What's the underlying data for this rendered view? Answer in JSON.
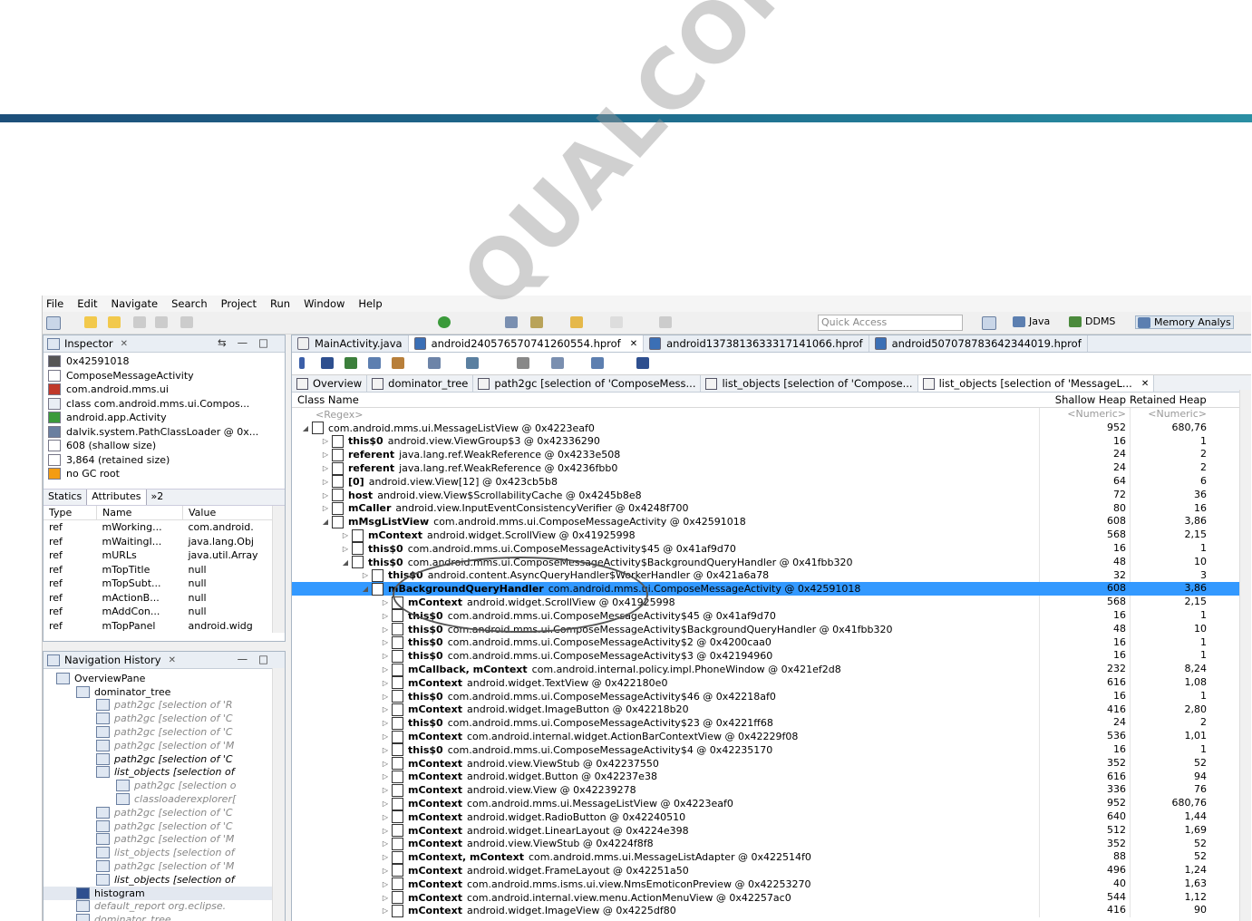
{
  "menu": [
    "File",
    "Edit",
    "Navigate",
    "Search",
    "Project",
    "Run",
    "Window",
    "Help"
  ],
  "quick_access": "Quick Access",
  "perspectives": [
    "Java",
    "DDMS",
    "Memory Analys"
  ],
  "watermark": "QUALCOMM",
  "inspector": {
    "title": "Inspector",
    "rows": [
      "0x42591018",
      "ComposeMessageActivity",
      "com.android.mms.ui",
      "class com.android.mms.ui.Compos...",
      "android.app.Activity",
      "dalvik.system.PathClassLoader @ 0x...",
      "608 (shallow size)",
      "3,864 (retained size)",
      "no GC root"
    ],
    "subtabs": [
      "Statics",
      "Attributes",
      "»2"
    ],
    "columns": [
      "Type",
      "Name",
      "Value"
    ],
    "attrs": [
      [
        "ref",
        "mWorking...",
        "com.android."
      ],
      [
        "ref",
        "mWaitingI...",
        "java.lang.Obj"
      ],
      [
        "ref",
        "mURLs",
        "java.util.Array"
      ],
      [
        "ref",
        "mTopTitle",
        "null"
      ],
      [
        "ref",
        "mTopSubt...",
        "null"
      ],
      [
        "ref",
        "mActionB...",
        "null"
      ],
      [
        "ref",
        "mAddCon...",
        "null"
      ],
      [
        "ref",
        "mTopPanel",
        "android.widg"
      ]
    ]
  },
  "nav_history": {
    "title": "Navigation History",
    "rows": [
      {
        "text": "OverviewPane",
        "indent": 0,
        "style": ""
      },
      {
        "text": "dominator_tree",
        "indent": 1,
        "style": ""
      },
      {
        "text": "path2gc [selection of 'R",
        "indent": 2,
        "style": "grey"
      },
      {
        "text": "path2gc [selection of 'C",
        "indent": 2,
        "style": "grey"
      },
      {
        "text": "path2gc [selection of 'C",
        "indent": 2,
        "style": "grey"
      },
      {
        "text": "path2gc [selection of 'M",
        "indent": 2,
        "style": "grey"
      },
      {
        "text": "path2gc [selection of 'C",
        "indent": 2,
        "style": "it"
      },
      {
        "text": "list_objects [selection of",
        "indent": 2,
        "style": "it"
      },
      {
        "text": "path2gc [selection o",
        "indent": 3,
        "style": "grey"
      },
      {
        "text": "classloaderexplorer[",
        "indent": 3,
        "style": "grey"
      },
      {
        "text": "path2gc [selection of 'C",
        "indent": 2,
        "style": "grey"
      },
      {
        "text": "path2gc [selection of 'C",
        "indent": 2,
        "style": "grey"
      },
      {
        "text": "path2gc [selection of 'M",
        "indent": 2,
        "style": "grey"
      },
      {
        "text": "list_objects [selection of",
        "indent": 2,
        "style": "grey"
      },
      {
        "text": "path2gc [selection of 'M",
        "indent": 2,
        "style": "grey"
      },
      {
        "text": "list_objects [selection of",
        "indent": 2,
        "style": "it"
      },
      {
        "text": "histogram",
        "indent": 1,
        "style": "hl"
      },
      {
        "text": "default_report  org.eclipse.",
        "indent": 1,
        "style": "grey"
      },
      {
        "text": "dominator_tree",
        "indent": 1,
        "style": "grey"
      }
    ]
  },
  "editor_tabs": [
    "MainActivity.java",
    "android240576570741260554.hprof",
    "android1373813633317141066.hprof",
    "android507078783642344019.hprof"
  ],
  "query_tabs": [
    "Overview",
    "dominator_tree",
    "path2gc [selection of 'ComposeMess...",
    "list_objects [selection of 'Compose...",
    "list_objects [selection of 'MessageL..."
  ],
  "columns": {
    "name": "Class Name",
    "shallow": "Shallow Heap",
    "retained": "Retained Heap"
  },
  "filter": {
    "name": "<Regex>",
    "shallow": "<Numeric>",
    "retained": "<Numeric>"
  },
  "rows": [
    {
      "level": 0,
      "tw": "◢",
      "bold": "",
      "text": "com.android.mms.ui.MessageListView @ 0x4223eaf0",
      "sh": "952",
      "rt": "680,76"
    },
    {
      "level": 1,
      "tw": "▷",
      "bold": "this$0",
      "text": "android.view.ViewGroup$3 @ 0x42336290",
      "sh": "16",
      "rt": "1"
    },
    {
      "level": 1,
      "tw": "▷",
      "bold": "referent",
      "text": "java.lang.ref.WeakReference @ 0x4233e508",
      "sh": "24",
      "rt": "2"
    },
    {
      "level": 1,
      "tw": "▷",
      "bold": "referent",
      "text": "java.lang.ref.WeakReference @ 0x4236fbb0",
      "sh": "24",
      "rt": "2"
    },
    {
      "level": 1,
      "tw": "▷",
      "bold": "[0]",
      "text": "android.view.View[12] @ 0x423cb5b8",
      "sh": "64",
      "rt": "6"
    },
    {
      "level": 1,
      "tw": "▷",
      "bold": "host",
      "text": "android.view.View$ScrollabilityCache @ 0x4245b8e8",
      "sh": "72",
      "rt": "36"
    },
    {
      "level": 1,
      "tw": "▷",
      "bold": "mCaller",
      "text": "android.view.InputEventConsistencyVerifier @ 0x4248f700",
      "sh": "80",
      "rt": "16"
    },
    {
      "level": 1,
      "tw": "◢",
      "bold": "mMsgListView",
      "text": "com.android.mms.ui.ComposeMessageActivity @ 0x42591018",
      "sh": "608",
      "rt": "3,86"
    },
    {
      "level": 2,
      "tw": "▷",
      "bold": "mContext",
      "text": "android.widget.ScrollView @ 0x41925998",
      "sh": "568",
      "rt": "2,15"
    },
    {
      "level": 2,
      "tw": "▷",
      "bold": "this$0",
      "text": "com.android.mms.ui.ComposeMessageActivity$45 @ 0x41af9d70",
      "sh": "16",
      "rt": "1"
    },
    {
      "level": 2,
      "tw": "◢",
      "bold": "this$0",
      "text": "com.android.mms.ui.ComposeMessageActivity$BackgroundQueryHandler @ 0x41fbb320",
      "sh": "48",
      "rt": "10"
    },
    {
      "level": 3,
      "tw": "▷",
      "bold": "this$0",
      "text": "android.content.AsyncQueryHandler$WorkerHandler @ 0x421a6a78",
      "sh": "32",
      "rt": "3"
    },
    {
      "level": 3,
      "tw": "◢",
      "bold": "mBackgroundQueryHandler",
      "text": "com.android.mms.ui.ComposeMessageActivity @ 0x42591018",
      "sh": "608",
      "rt": "3,86",
      "sel": true
    },
    {
      "level": 4,
      "tw": "▷",
      "bold": "mContext",
      "text": "android.widget.ScrollView @ 0x41925998",
      "sh": "568",
      "rt": "2,15"
    },
    {
      "level": 4,
      "tw": "▷",
      "bold": "this$0",
      "text": "com.android.mms.ui.ComposeMessageActivity$45 @ 0x41af9d70",
      "sh": "16",
      "rt": "1"
    },
    {
      "level": 4,
      "tw": "▷",
      "bold": "this$0",
      "text": "com.android.mms.ui.ComposeMessageActivity$BackgroundQueryHandler @ 0x41fbb320",
      "sh": "48",
      "rt": "10"
    },
    {
      "level": 4,
      "tw": "▷",
      "bold": "this$0",
      "text": "com.android.mms.ui.ComposeMessageActivity$2 @ 0x4200caa0",
      "sh": "16",
      "rt": "1"
    },
    {
      "level": 4,
      "tw": "▷",
      "bold": "this$0",
      "text": "com.android.mms.ui.ComposeMessageActivity$3 @ 0x42194960",
      "sh": "16",
      "rt": "1"
    },
    {
      "level": 4,
      "tw": "▷",
      "bold": "mCallback, mContext",
      "text": "com.android.internal.policy.impl.PhoneWindow @ 0x421ef2d8",
      "sh": "232",
      "rt": "8,24"
    },
    {
      "level": 4,
      "tw": "▷",
      "bold": "mContext",
      "text": "android.widget.TextView @ 0x422180e0",
      "sh": "616",
      "rt": "1,08"
    },
    {
      "level": 4,
      "tw": "▷",
      "bold": "this$0",
      "text": "com.android.mms.ui.ComposeMessageActivity$46 @ 0x42218af0",
      "sh": "16",
      "rt": "1"
    },
    {
      "level": 4,
      "tw": "▷",
      "bold": "mContext",
      "text": "android.widget.ImageButton @ 0x42218b20",
      "sh": "416",
      "rt": "2,80"
    },
    {
      "level": 4,
      "tw": "▷",
      "bold": "this$0",
      "text": "com.android.mms.ui.ComposeMessageActivity$23 @ 0x4221ff68",
      "sh": "24",
      "rt": "2"
    },
    {
      "level": 4,
      "tw": "▷",
      "bold": "mContext",
      "text": "com.android.internal.widget.ActionBarContextView @ 0x42229f08",
      "sh": "536",
      "rt": "1,01"
    },
    {
      "level": 4,
      "tw": "▷",
      "bold": "this$0",
      "text": "com.android.mms.ui.ComposeMessageActivity$4 @ 0x42235170",
      "sh": "16",
      "rt": "1"
    },
    {
      "level": 4,
      "tw": "▷",
      "bold": "mContext",
      "text": "android.view.ViewStub @ 0x42237550",
      "sh": "352",
      "rt": "52"
    },
    {
      "level": 4,
      "tw": "▷",
      "bold": "mContext",
      "text": "android.widget.Button @ 0x42237e38",
      "sh": "616",
      "rt": "94"
    },
    {
      "level": 4,
      "tw": "▷",
      "bold": "mContext",
      "text": "android.view.View @ 0x42239278",
      "sh": "336",
      "rt": "76"
    },
    {
      "level": 4,
      "tw": "▷",
      "bold": "mContext",
      "text": "com.android.mms.ui.MessageListView @ 0x4223eaf0",
      "sh": "952",
      "rt": "680,76"
    },
    {
      "level": 4,
      "tw": "▷",
      "bold": "mContext",
      "text": "android.widget.RadioButton @ 0x42240510",
      "sh": "640",
      "rt": "1,44"
    },
    {
      "level": 4,
      "tw": "▷",
      "bold": "mContext",
      "text": "android.widget.LinearLayout @ 0x4224e398",
      "sh": "512",
      "rt": "1,69"
    },
    {
      "level": 4,
      "tw": "▷",
      "bold": "mContext",
      "text": "android.view.ViewStub @ 0x4224f8f8",
      "sh": "352",
      "rt": "52"
    },
    {
      "level": 4,
      "tw": "▷",
      "bold": "mContext, mContext",
      "text": "com.android.mms.ui.MessageListAdapter @ 0x422514f0",
      "sh": "88",
      "rt": "52"
    },
    {
      "level": 4,
      "tw": "▷",
      "bold": "mContext",
      "text": "android.widget.FrameLayout @ 0x42251a50",
      "sh": "496",
      "rt": "1,24"
    },
    {
      "level": 4,
      "tw": "▷",
      "bold": "mContext",
      "text": "com.android.mms.isms.ui.view.NmsEmoticonPreview @ 0x42253270",
      "sh": "40",
      "rt": "1,63"
    },
    {
      "level": 4,
      "tw": "▷",
      "bold": "mContext",
      "text": "com.android.internal.view.menu.ActionMenuView @ 0x42257ac0",
      "sh": "544",
      "rt": "1,12"
    },
    {
      "level": 4,
      "tw": "▷",
      "bold": "mContext",
      "text": "android.widget.ImageView @ 0x4225df80",
      "sh": "416",
      "rt": "90"
    }
  ]
}
